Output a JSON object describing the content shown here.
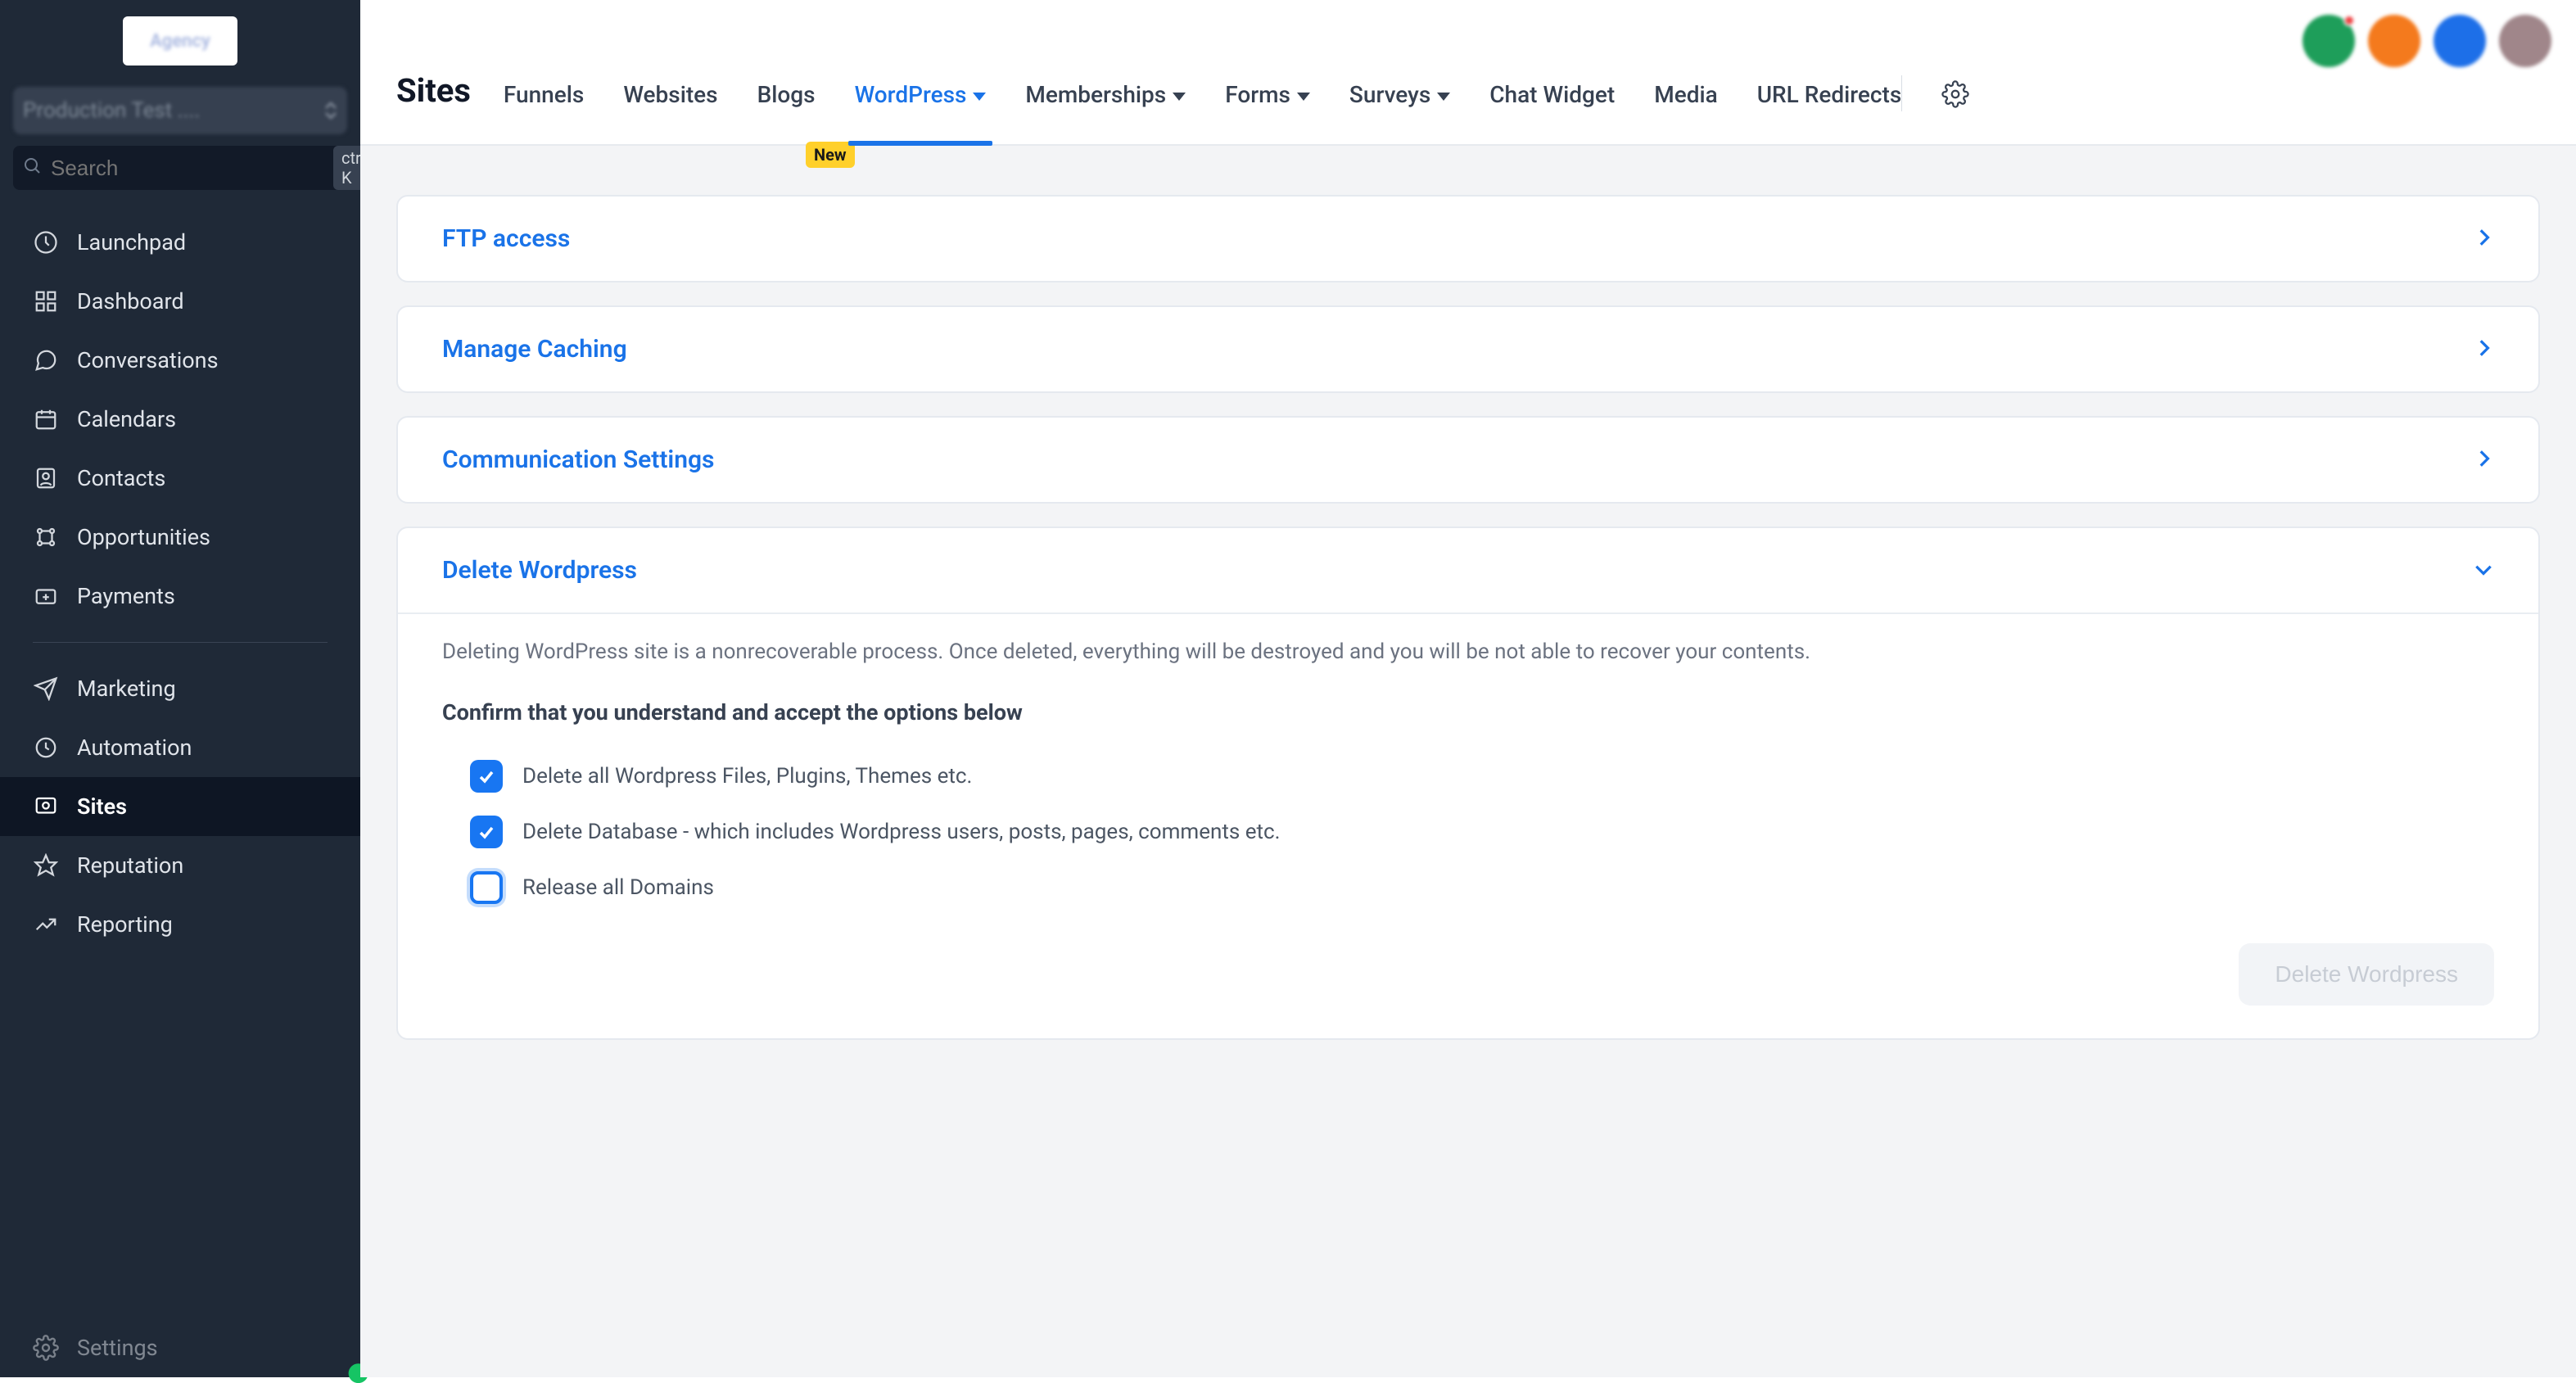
{
  "sidebar": {
    "logo_text": "Agency",
    "account_label": "Production Test ....",
    "search_placeholder": "Search",
    "search_shortcut": "ctrl K",
    "items_primary": [
      {
        "id": "launchpad",
        "label": "Launchpad"
      },
      {
        "id": "dashboard",
        "label": "Dashboard"
      },
      {
        "id": "conversations",
        "label": "Conversations"
      },
      {
        "id": "calendars",
        "label": "Calendars"
      },
      {
        "id": "contacts",
        "label": "Contacts"
      },
      {
        "id": "opportunities",
        "label": "Opportunities"
      },
      {
        "id": "payments",
        "label": "Payments"
      }
    ],
    "items_secondary": [
      {
        "id": "marketing",
        "label": "Marketing"
      },
      {
        "id": "automation",
        "label": "Automation"
      },
      {
        "id": "sites",
        "label": "Sites",
        "active": true
      },
      {
        "id": "reputation",
        "label": "Reputation"
      },
      {
        "id": "reporting",
        "label": "Reporting"
      }
    ],
    "bottom_item": {
      "id": "settings",
      "label": "Settings"
    }
  },
  "header": {
    "page_title": "Sites",
    "tabs": [
      {
        "id": "funnels",
        "label": "Funnels",
        "dropdown": false
      },
      {
        "id": "websites",
        "label": "Websites",
        "dropdown": false
      },
      {
        "id": "blogs",
        "label": "Blogs",
        "dropdown": false,
        "badge": "New"
      },
      {
        "id": "wordpress",
        "label": "WordPress",
        "dropdown": true,
        "active": true
      },
      {
        "id": "memberships",
        "label": "Memberships",
        "dropdown": true
      },
      {
        "id": "forms",
        "label": "Forms",
        "dropdown": true
      },
      {
        "id": "surveys",
        "label": "Surveys",
        "dropdown": true
      },
      {
        "id": "chat-widget",
        "label": "Chat Widget",
        "dropdown": false
      },
      {
        "id": "media",
        "label": "Media",
        "dropdown": false
      },
      {
        "id": "url-redirects",
        "label": "URL Redirects",
        "dropdown": false
      }
    ]
  },
  "panels": {
    "ftp": "FTP access",
    "caching": "Manage Caching",
    "comm": "Communication Settings",
    "delete": "Delete Wordpress"
  },
  "delete_section": {
    "warning": "Deleting WordPress site is a nonrecoverable process. Once deleted, everything will be destroyed and you will be not able to recover your contents.",
    "confirm_title": "Confirm that you understand and accept the options below",
    "options": [
      {
        "id": "files",
        "label": "Delete all Wordpress Files, Plugins, Themes etc.",
        "checked": true
      },
      {
        "id": "db",
        "label": "Delete Database - which includes Wordpress users, posts, pages, comments etc.",
        "checked": true
      },
      {
        "id": "domains",
        "label": "Release all Domains",
        "checked": false,
        "focused": true
      }
    ],
    "button_label": "Delete Wordpress"
  }
}
